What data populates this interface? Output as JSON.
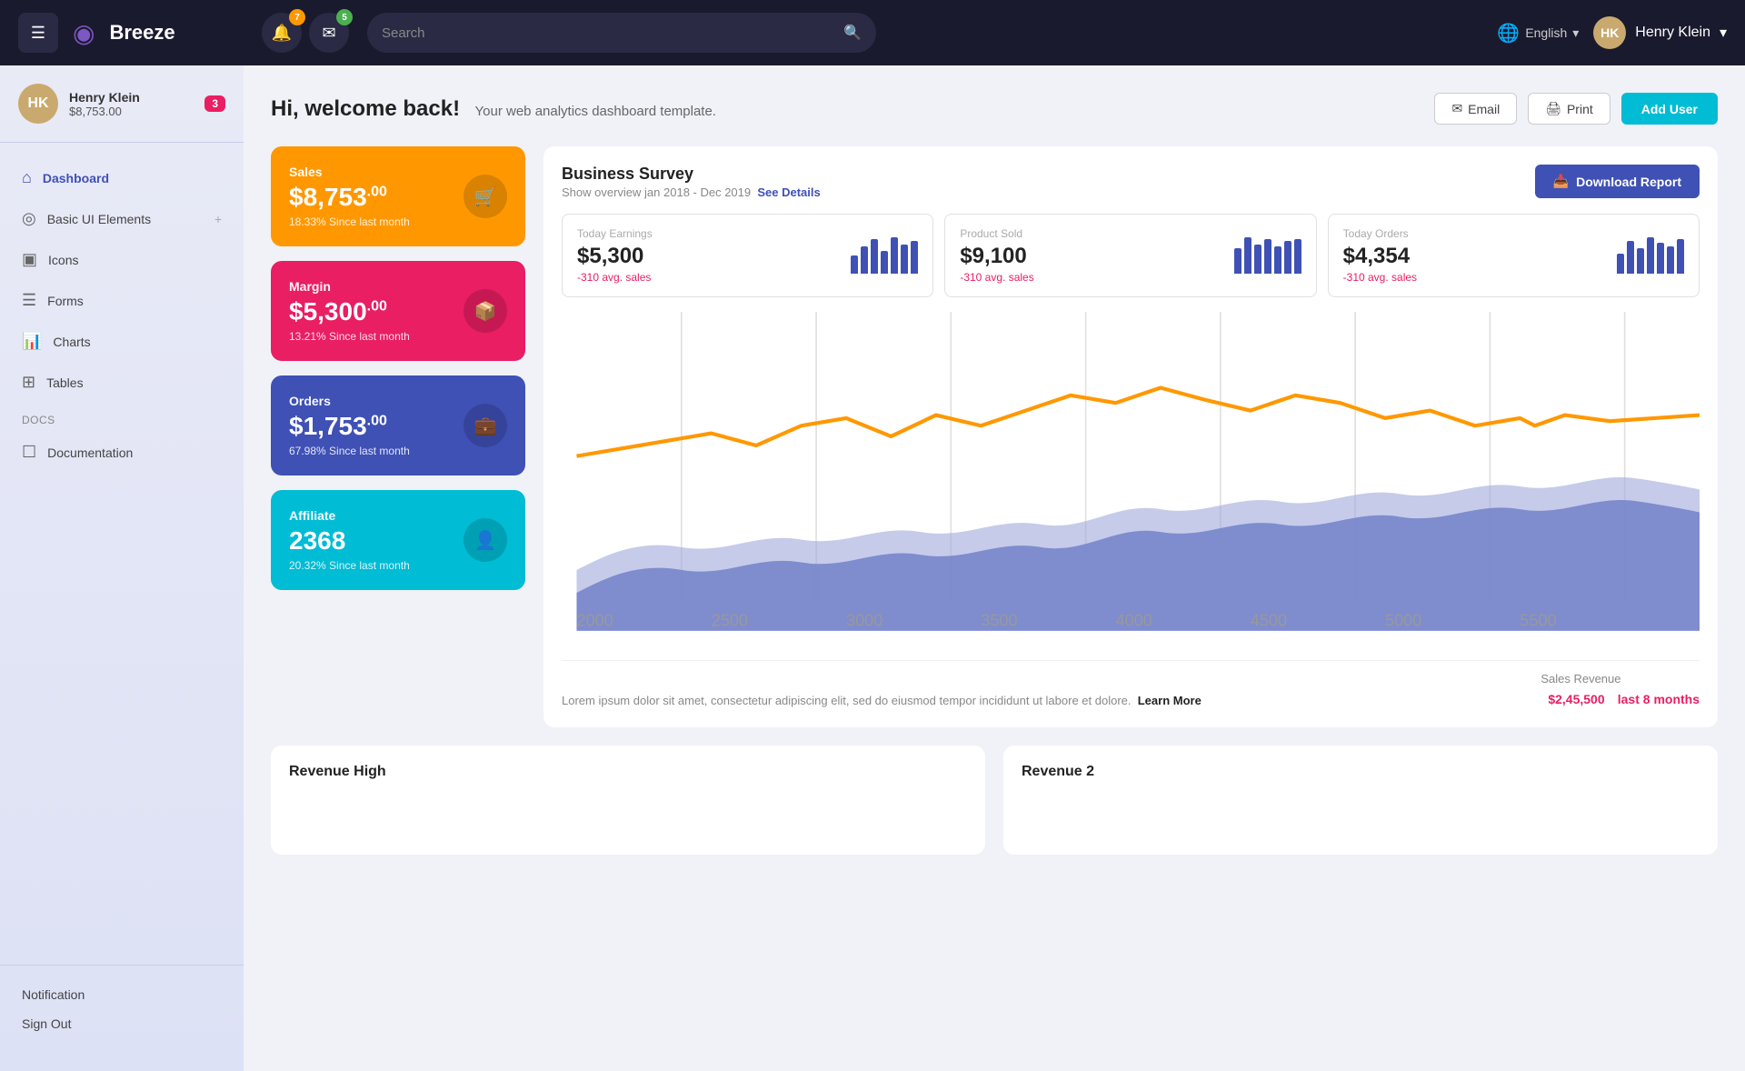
{
  "brand": {
    "name": "Breeze",
    "logo_icon": "◉"
  },
  "topnav": {
    "menu_icon": "☰",
    "notifications_count": "7",
    "messages_count": "5",
    "search_placeholder": "Search",
    "language": "English",
    "user_name": "Henry Klein",
    "user_initials": "HK"
  },
  "sidebar": {
    "user": {
      "name": "Henry Klein",
      "balance": "$8,753.00",
      "badge": "3",
      "initials": "HK"
    },
    "nav_items": [
      {
        "id": "dashboard",
        "label": "Dashboard",
        "icon": "⌂",
        "active": true
      },
      {
        "id": "basic-ui",
        "label": "Basic UI Elements",
        "icon": "◎",
        "has_plus": true
      },
      {
        "id": "icons",
        "label": "Icons",
        "icon": "▣"
      },
      {
        "id": "forms",
        "label": "Forms",
        "icon": "☰"
      },
      {
        "id": "charts",
        "label": "Charts",
        "icon": "▐"
      },
      {
        "id": "tables",
        "label": "Tables",
        "icon": "⊞"
      }
    ],
    "section_labels": [
      {
        "id": "docs",
        "label": "Docs"
      }
    ],
    "doc_items": [
      {
        "id": "documentation",
        "label": "Documentation",
        "icon": "☐"
      }
    ],
    "footer_items": [
      {
        "id": "notification",
        "label": "Notification"
      },
      {
        "id": "signout",
        "label": "Sign Out"
      }
    ]
  },
  "welcome": {
    "greeting": "Hi, welcome back!",
    "subtitle": "Your web analytics dashboard template.",
    "email_btn": "Email",
    "print_btn": "Print",
    "add_user_btn": "Add User"
  },
  "stat_cards": [
    {
      "id": "sales",
      "label": "Sales",
      "amount": "$8,753",
      "cents": ".00",
      "since": "18.33% Since last month",
      "color": "orange",
      "icon": "🛒"
    },
    {
      "id": "margin",
      "label": "Margin",
      "amount": "$5,300",
      "cents": ".00",
      "since": "13.21% Since last month",
      "color": "pink",
      "icon": "📦"
    },
    {
      "id": "orders",
      "label": "Orders",
      "amount": "$1,753",
      "cents": ".00",
      "since": "67.98% Since last month",
      "color": "blue",
      "icon": "💼"
    },
    {
      "id": "affiliate",
      "label": "Affiliate",
      "amount": "2368",
      "cents": "",
      "since": "20.32% Since last month",
      "color": "teal",
      "icon": "👤"
    }
  ],
  "survey": {
    "title": "Business Survey",
    "subtitle": "Show overview jan 2018 - Dec 2019",
    "see_details": "See Details",
    "download_btn": "Download Report",
    "mini_stats": [
      {
        "label": "Today Earnings",
        "value": "$5,300",
        "change": "-310 avg. sales",
        "bars": [
          20,
          35,
          45,
          30,
          55,
          40,
          60
        ]
      },
      {
        "label": "Product Sold",
        "value": "$9,100",
        "change": "-310 avg. sales",
        "bars": [
          30,
          50,
          35,
          55,
          40,
          65,
          45
        ]
      },
      {
        "label": "Today Orders",
        "value": "$4,354",
        "change": "-310 avg. sales",
        "bars": [
          25,
          40,
          30,
          50,
          45,
          35,
          55
        ]
      }
    ],
    "chart_x_labels": [
      "2000",
      "2500",
      "3000",
      "3500",
      "4000",
      "4500",
      "5000",
      "5500"
    ],
    "footer_text": "Lorem ipsum dolor sit amet, consectetur adipiscing elit, sed do eiusmod tempor incididunt ut labore et dolore.",
    "learn_more": "Learn More",
    "sales_revenue_label": "Sales Revenue",
    "sales_revenue_value": "$2,45,500",
    "sales_revenue_period": "last 8 months"
  },
  "bottom_cards": [
    {
      "id": "revenue-high",
      "title": "Revenue High"
    },
    {
      "id": "revenue-2",
      "title": "Revenue 2"
    }
  ]
}
